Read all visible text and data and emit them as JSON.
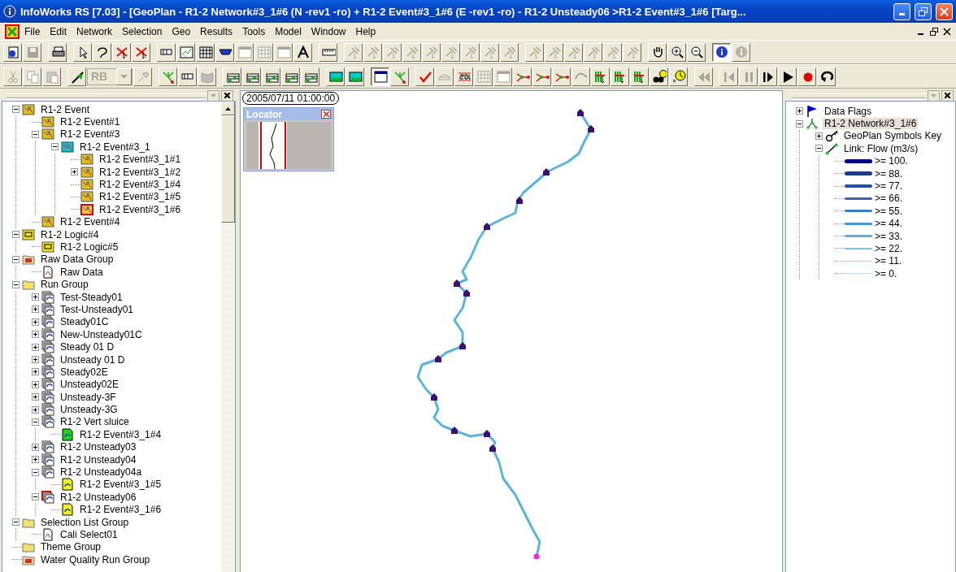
{
  "window": {
    "title": "InfoWorks RS [7.03] - [GeoPlan - R1-2 Network#3_1#6 (N -rev1 -ro) + R1-2 Event#3_1#6 (E -rev1 -ro) - R1-2 Unsteady06 >R1-2 Event#3_1#6  [Targ..."
  },
  "menu": [
    "File",
    "Edit",
    "Network",
    "Selection",
    "Geo",
    "Results",
    "Tools",
    "Model",
    "Window",
    "Help"
  ],
  "toolbars": [
    [
      [
        {
          "kind": "info-doc",
          "disabled": false,
          "pressed": false
        },
        {
          "kind": "save",
          "disabled": true,
          "pressed": false
        }
      ],
      [
        {
          "kind": "print",
          "disabled": false,
          "pressed": false
        }
      ],
      [
        {
          "kind": "pointer",
          "disabled": false,
          "pressed": false
        },
        {
          "kind": "lasso",
          "disabled": false,
          "pressed": false
        },
        {
          "kind": "cross-pointer",
          "disabled": false,
          "pressed": false
        },
        {
          "kind": "cross-pointer",
          "disabled": false,
          "pressed": false
        }
      ],
      [
        {
          "kind": "table-pointer",
          "disabled": false,
          "pressed": false
        },
        {
          "kind": "graph",
          "disabled": false,
          "pressed": false
        },
        {
          "kind": "grid",
          "disabled": false,
          "pressed": false
        },
        {
          "kind": "section",
          "disabled": false,
          "pressed": false
        },
        {
          "kind": "window",
          "disabled": true,
          "pressed": false
        },
        {
          "kind": "grid",
          "disabled": true,
          "pressed": false
        },
        {
          "kind": "window",
          "disabled": true,
          "pressed": false
        },
        {
          "kind": "text",
          "disabled": false,
          "pressed": false
        }
      ],
      [
        {
          "kind": "ruler",
          "disabled": false,
          "pressed": false
        }
      ],
      [
        {
          "kind": "tool",
          "disabled": true,
          "pressed": false
        },
        {
          "kind": "tool",
          "disabled": true,
          "pressed": false
        },
        {
          "kind": "tool",
          "disabled": true,
          "pressed": false
        },
        {
          "kind": "tool",
          "disabled": true,
          "pressed": false
        },
        {
          "kind": "tool",
          "disabled": true,
          "pressed": false
        },
        {
          "kind": "tool",
          "disabled": true,
          "pressed": false
        },
        {
          "kind": "tool",
          "disabled": true,
          "pressed": false
        },
        {
          "kind": "tool",
          "disabled": true,
          "pressed": false
        },
        {
          "kind": "tool",
          "disabled": true,
          "pressed": false
        }
      ],
      [
        {
          "kind": "tool",
          "disabled": true,
          "pressed": false
        },
        {
          "kind": "tool",
          "disabled": true,
          "pressed": false
        },
        {
          "kind": "tool",
          "disabled": true,
          "pressed": false
        },
        {
          "kind": "tool",
          "disabled": true,
          "pressed": false
        },
        {
          "kind": "tool",
          "disabled": true,
          "pressed": false
        },
        {
          "kind": "tool",
          "disabled": true,
          "pressed": false
        }
      ],
      [
        {
          "kind": "hand",
          "disabled": false,
          "pressed": false
        },
        {
          "kind": "zoom-in",
          "disabled": false,
          "pressed": false
        },
        {
          "kind": "zoom-out",
          "disabled": false,
          "pressed": false
        }
      ],
      [
        {
          "kind": "info",
          "disabled": false,
          "pressed": true
        },
        {
          "kind": "info",
          "disabled": true,
          "pressed": false
        }
      ]
    ],
    [
      [
        {
          "kind": "cut",
          "disabled": true,
          "pressed": false
        },
        {
          "kind": "copy",
          "disabled": true,
          "pressed": false
        },
        {
          "kind": "paste",
          "disabled": true,
          "pressed": false
        }
      ],
      [
        {
          "kind": "flag",
          "disabled": false,
          "pressed": false
        },
        {
          "kind": "combo",
          "value": "RB",
          "disabled": true
        },
        {
          "kind": "pin",
          "disabled": true,
          "pressed": false
        }
      ],
      [
        {
          "kind": "tree",
          "disabled": false,
          "pressed": false
        },
        {
          "kind": "table-pointer",
          "disabled": false,
          "pressed": false
        },
        {
          "kind": "book",
          "disabled": true,
          "pressed": false
        }
      ],
      [
        {
          "kind": "grid-node",
          "disabled": false,
          "pressed": false
        },
        {
          "kind": "grid-node",
          "disabled": false,
          "pressed": false
        },
        {
          "kind": "grid-node",
          "disabled": false,
          "pressed": false
        },
        {
          "kind": "grid-node",
          "disabled": false,
          "pressed": false
        },
        {
          "kind": "grid-node",
          "disabled": false,
          "pressed": false
        }
      ],
      [
        {
          "kind": "network",
          "disabled": false,
          "pressed": false
        },
        {
          "kind": "network",
          "disabled": false,
          "pressed": false
        }
      ],
      [
        {
          "kind": "window",
          "disabled": false,
          "pressed": true
        },
        {
          "kind": "tree",
          "disabled": false,
          "pressed": false
        }
      ],
      [
        {
          "kind": "check",
          "disabled": false,
          "pressed": false
        },
        {
          "kind": "bridge",
          "disabled": true,
          "pressed": false
        },
        {
          "kind": "sql",
          "disabled": false,
          "pressed": false
        },
        {
          "kind": "grid",
          "disabled": true,
          "pressed": false
        },
        {
          "kind": "window",
          "disabled": true,
          "pressed": false
        },
        {
          "kind": "node",
          "disabled": false,
          "pressed": false
        },
        {
          "kind": "node",
          "disabled": false,
          "pressed": false
        },
        {
          "kind": "node",
          "disabled": false,
          "pressed": false
        },
        {
          "kind": "curve",
          "disabled": true,
          "pressed": false
        },
        {
          "kind": "chart",
          "disabled": false,
          "pressed": false
        },
        {
          "kind": "chart",
          "disabled": false,
          "pressed": false
        },
        {
          "kind": "chart",
          "disabled": false,
          "pressed": false
        },
        {
          "kind": "binoculars",
          "disabled": false,
          "pressed": false
        },
        {
          "kind": "clock",
          "disabled": false,
          "pressed": false
        }
      ],
      [
        {
          "kind": "rewind",
          "disabled": true,
          "pressed": false
        }
      ],
      [
        {
          "kind": "step-back",
          "disabled": true,
          "pressed": false
        },
        {
          "kind": "pause",
          "disabled": true,
          "pressed": false
        },
        {
          "kind": "step-forward",
          "disabled": false,
          "pressed": false
        },
        {
          "kind": "play",
          "disabled": false,
          "pressed": false
        },
        {
          "kind": "record",
          "disabled": false,
          "pressed": false
        },
        {
          "kind": "loop",
          "disabled": false,
          "pressed": false
        }
      ]
    ]
  ],
  "explorer": {
    "items": [
      {
        "label": "R1-2 Event",
        "kind": "event",
        "expanded": true,
        "children": [
          {
            "label": "R1-2 Event#1",
            "kind": "event"
          },
          {
            "label": "R1-2 Event#3",
            "kind": "event",
            "expanded": true,
            "children": [
              {
                "label": "R1-2 Event#3_1",
                "kind": "event-cyan",
                "expanded": true,
                "children": [
                  {
                    "label": "R1-2 Event#3_1#1",
                    "kind": "event"
                  },
                  {
                    "label": "R1-2 Event#3_1#2",
                    "kind": "event",
                    "expanded": false
                  },
                  {
                    "label": "R1-2 Event#3_1#4",
                    "kind": "event"
                  },
                  {
                    "label": "R1-2 Event#3_1#5",
                    "kind": "event"
                  },
                  {
                    "label": "R1-2 Event#3_1#6",
                    "kind": "event-red"
                  }
                ]
              }
            ]
          },
          {
            "label": "R1-2 Event#4",
            "kind": "event"
          }
        ]
      },
      {
        "label": "R1-2 Logic#4",
        "kind": "logic",
        "expanded": true,
        "children": [
          {
            "label": "R1-2 Logic#5",
            "kind": "logic"
          }
        ]
      },
      {
        "label": "Raw Data Group",
        "kind": "data-folder",
        "expanded": true,
        "children": [
          {
            "label": "Raw Data",
            "kind": "doc"
          }
        ]
      },
      {
        "label": "Run Group",
        "kind": "folder",
        "expanded": true,
        "children": [
          {
            "label": "Test-Steady01",
            "kind": "run",
            "expanded": false
          },
          {
            "label": "Test-Unsteady01",
            "kind": "run",
            "expanded": false
          },
          {
            "label": "Steady01C",
            "kind": "run",
            "expanded": false
          },
          {
            "label": "New-Unsteady01C",
            "kind": "run",
            "expanded": false
          },
          {
            "label": "Steady 01 D",
            "kind": "run",
            "expanded": false
          },
          {
            "label": "Unsteady 01 D",
            "kind": "run",
            "expanded": false
          },
          {
            "label": "Steady02E",
            "kind": "run",
            "expanded": false
          },
          {
            "label": "Unsteady02E",
            "kind": "run",
            "expanded": false
          },
          {
            "label": "Unsteady-3F",
            "kind": "run",
            "expanded": false
          },
          {
            "label": "Unsteady-3G",
            "kind": "run",
            "expanded": false
          },
          {
            "label": "R1-2 Vert sluice",
            "kind": "run",
            "expanded": true,
            "children": [
              {
                "label": "R1-2 Event#3_1#4",
                "kind": "sim-green"
              }
            ]
          },
          {
            "label": "R1-2 Unsteady03",
            "kind": "run",
            "expanded": false
          },
          {
            "label": "R1-2 Unsteady04",
            "kind": "run",
            "expanded": false
          },
          {
            "label": "R1-2 Unsteady04a",
            "kind": "run",
            "expanded": true,
            "children": [
              {
                "label": "R1-2 Event#3_1#5",
                "kind": "sim-yellow"
              }
            ]
          },
          {
            "label": "R1-2 Unsteady06",
            "kind": "run-red",
            "expanded": true,
            "children": [
              {
                "label": "R1-2 Event#3_1#6",
                "kind": "sim-yellow"
              }
            ]
          }
        ]
      },
      {
        "label": "Selection List Group",
        "kind": "folder",
        "expanded": true,
        "children": [
          {
            "label": "Cali Select01",
            "kind": "doc"
          }
        ]
      },
      {
        "label": "Theme Group",
        "kind": "folder"
      },
      {
        "label": "Water Quality Run Group",
        "kind": "data-folder"
      }
    ]
  },
  "geoplan": {
    "timestamp": "2005/07/11 01:00:00",
    "locator": {
      "title": "Locator"
    }
  },
  "legend": {
    "items": [
      {
        "label": "Data Flags",
        "kind": "flag",
        "expanded": false,
        "selected": false
      },
      {
        "label": "R1-2 Network#3_1#6",
        "kind": "network",
        "expanded": true,
        "selected": true,
        "children": [
          {
            "label": "GeoPlan Symbols Key",
            "kind": "key",
            "expanded": false,
            "selected": false
          },
          {
            "label": "Link: Flow (m3/s)",
            "kind": "link",
            "expanded": true,
            "selected": false,
            "children": [
              {
                "label": ">= 100.",
                "kind": "band",
                "color": "#000080",
                "selected": false
              },
              {
                "label": ">= 88.",
                "kind": "band",
                "color": "#1c3a9e",
                "selected": false
              },
              {
                "label": ">= 77.",
                "kind": "band",
                "color": "#2450aa",
                "selected": false
              },
              {
                "label": ">= 66.",
                "kind": "band",
                "color": "#3468b8",
                "selected": false
              },
              {
                "label": ">= 55.",
                "kind": "band",
                "color": "#3c7cc0",
                "selected": false
              },
              {
                "label": ">= 44.",
                "kind": "band",
                "color": "#4a94cc",
                "selected": false
              },
              {
                "label": ">= 33.",
                "kind": "band",
                "color": "#5eb0dc",
                "selected": false
              },
              {
                "label": ">= 22.",
                "kind": "band",
                "color": "#70c8e6",
                "selected": false
              },
              {
                "label": ">= 11.",
                "kind": "band",
                "color": "#98def0",
                "selected": false
              },
              {
                "label": ">= 0.",
                "kind": "band",
                "color": "#b4eaf6",
                "selected": false
              }
            ]
          }
        ]
      }
    ]
  }
}
